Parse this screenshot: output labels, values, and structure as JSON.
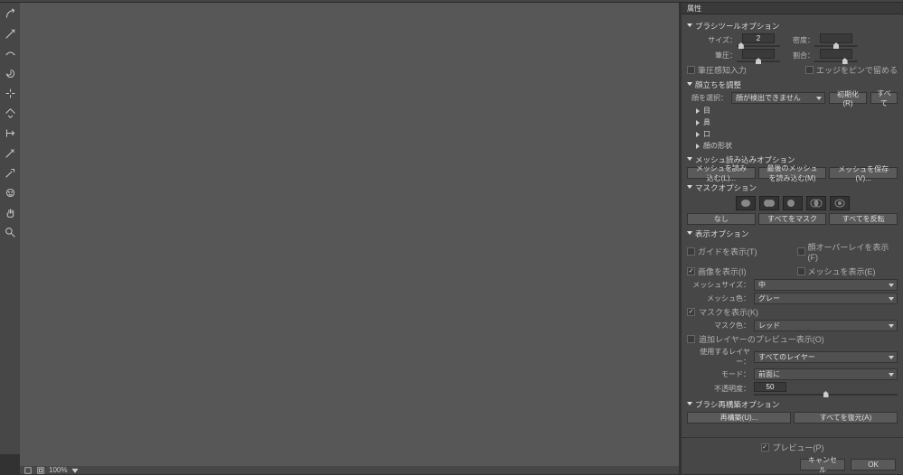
{
  "panelTitle": "属性",
  "zoom": "100%",
  "sections": {
    "brushTool": {
      "title": "ブラシツールオプション",
      "size": {
        "label": "サイズ：",
        "value": "2"
      },
      "density": {
        "label": "密度：",
        "value": ""
      },
      "pressure": {
        "label": "筆圧：",
        "value": ""
      },
      "rate": {
        "label": "割合：",
        "value": ""
      },
      "usePressure": "筆圧感知入力",
      "pinEdges": "エッジをピンで留める"
    },
    "faceAware": {
      "title": "顔立ちを調整",
      "selectLabel": "顔を選択：",
      "selectValue": "顔が検出できません",
      "resetBtn": "初期化(R)",
      "allBtn": "すべて",
      "items": [
        "目",
        "鼻",
        "口",
        "顔の形状"
      ]
    },
    "loadMesh": {
      "title": "メッシュ読み込みオプション",
      "loadBtn": "メッシュを読み込む(L)...",
      "lastBtn": "最後のメッシュを読み込む(M)",
      "saveBtn": "メッシュを保存(V)..."
    },
    "maskOptions": {
      "title": "マスクオプション",
      "noneBtn": "なし",
      "maskAllBtn": "すべてをマスク",
      "invertAllBtn": "すべてを反転"
    },
    "viewOptions": {
      "title": "表示オプション",
      "showGuide": "ガイドを表示(T)",
      "showFaceOverlay": "顔オーバーレイを表示(F)",
      "showImage": "画像を表示(I)",
      "showMesh": "メッシュを表示(E)",
      "meshSizeLabel": "メッシュサイズ：",
      "meshSizeValue": "中",
      "meshColorLabel": "メッシュ色：",
      "meshColorValue": "グレー",
      "showMask": "マスクを表示(K)",
      "maskColorLabel": "マスク色：",
      "maskColorValue": "レッド",
      "previewAdditional": "追加レイヤーのプレビュー表示(O)",
      "useLayerLabel": "使用するレイヤー：",
      "useLayerValue": "すべてのレイヤー",
      "modeLabel": "モード：",
      "modeValue": "前面に",
      "opacityLabel": "不透明度：",
      "opacityValue": "50"
    },
    "reconstruct": {
      "title": "ブラシ再構築オプション",
      "reconBtn": "再構築(U)...",
      "restoreBtn": "すべてを復元(A)"
    }
  },
  "footer": {
    "preview": "プレビュー(P)",
    "cancel": "キャンセル",
    "ok": "OK"
  }
}
